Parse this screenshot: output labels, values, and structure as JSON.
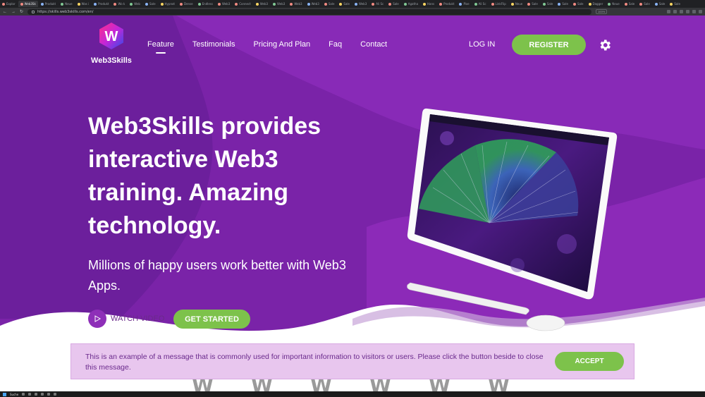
{
  "browser": {
    "tabs": [
      "Explor",
      "Web3Sk",
      "Produkt",
      "Neue",
      "Was i",
      "Produkt",
      "Wo k",
      "Web",
      "Sale",
      "Hypnot",
      "Dense",
      "Endless",
      "Web3",
      "Connect",
      "Web3",
      "Web3",
      "Web3",
      "Web3",
      "Sale",
      "Sale",
      "Web3",
      "Ali Sc",
      "Sale",
      "Agatha",
      "Hans",
      "Produkt",
      "Pixe",
      "Ali Sc",
      "LinkFlip",
      "Neue",
      "Sale",
      "Sale",
      "Sale",
      "Sale",
      "Dagger",
      "Neue",
      "Sale",
      "Sale",
      "Sale",
      "Sale"
    ],
    "active_tab_index": 1,
    "url": "https://skills.web3skills.com/en/",
    "zoom": "100%"
  },
  "brand": {
    "name": "Web3Skills",
    "logo_letter": "W"
  },
  "nav": {
    "items": [
      "Feature",
      "Testimonials",
      "Pricing And Plan",
      "Faq",
      "Contact"
    ],
    "active_index": 0,
    "login": "LOG IN",
    "register": "REGISTER"
  },
  "hero": {
    "headline": "Web3Skills provides interactive Web3 training. Amazing technology.",
    "subline": "Millions of happy users work better with Web3 Apps.",
    "watch_video": "WATCH VIDEO",
    "get_started": "GET STARTED"
  },
  "cookie": {
    "message": "This is an example of a message that is commonly used for important information to visitors or users. Please click the button beside to close this message.",
    "accept": "ACCEPT"
  },
  "taskbar": {
    "search": "Suche"
  },
  "colors": {
    "purple": "#7a23a8",
    "purple_dark": "#5e1c8f",
    "green": "#7dc24b",
    "cookie_bg": "#e8c6ee",
    "cookie_text": "#6a2a8c"
  },
  "icons": [
    "gear-icon",
    "play-icon",
    "lock-icon",
    "w-logo-icon"
  ]
}
